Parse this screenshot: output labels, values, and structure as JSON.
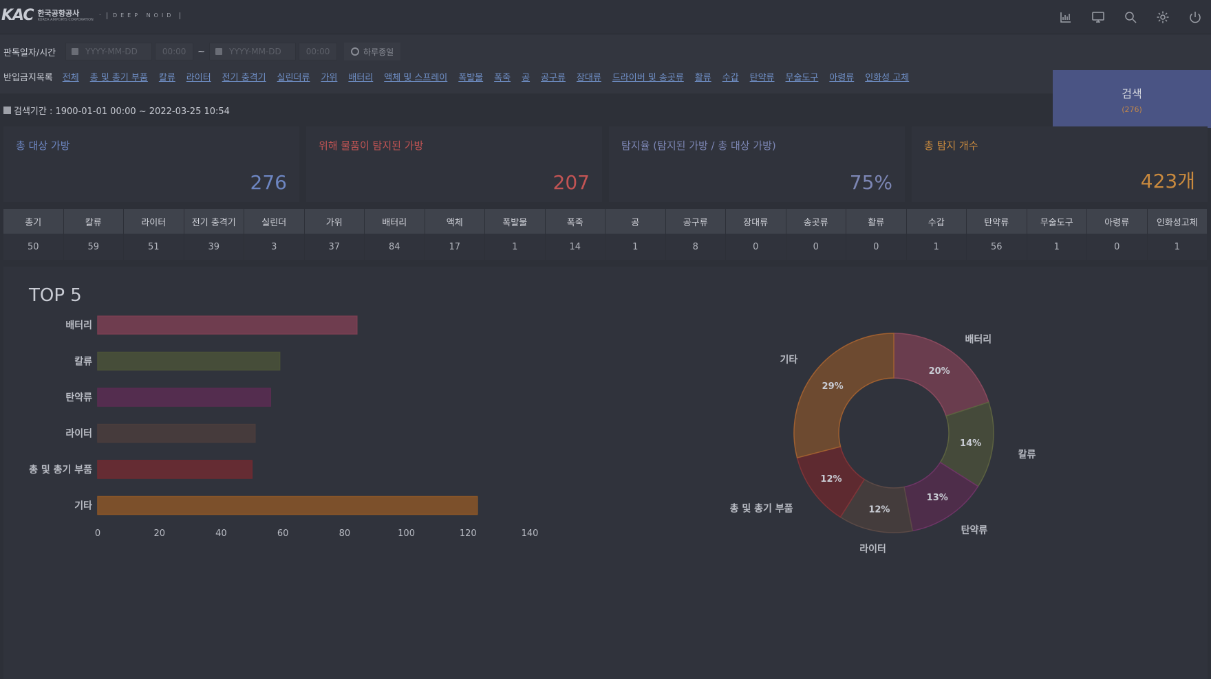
{
  "header": {
    "logo_text": "KAC",
    "logo_ko": "한국공항공사",
    "logo_en": "KOREA AIRPORTS CORPORATION",
    "partner": "DEEP NOID",
    "icons": [
      "chart-icon",
      "monitor-icon",
      "search-icon",
      "gear-icon",
      "power-icon"
    ]
  },
  "filter": {
    "date_label": "판독일자/시간",
    "start_date_placeholder": "YYYY-MM-DD",
    "start_time_placeholder": "00:00",
    "separator": "~",
    "end_date_placeholder": "YYYY-MM-DD",
    "end_time_placeholder": "00:00",
    "all_day_label": "하루종일",
    "category_label": "반입금지목록",
    "categories": [
      "전체",
      "총 및 총기 부품",
      "칼류",
      "라이터",
      "전기 충격기",
      "실린더류",
      "가위",
      "배터리",
      "액체 및 스프레이",
      "폭발물",
      "폭죽",
      "공",
      "공구류",
      "장대류",
      "드라이버 및 송곳류",
      "활류",
      "수갑",
      "탄약류",
      "무술도구",
      "아령류",
      "인화성 고체"
    ],
    "search_label": "검색",
    "search_count": "(276)"
  },
  "period": {
    "text": "검색기간 : 1900-01-01 00:00 ~ 2022-03-25 10:54"
  },
  "cards": [
    {
      "title": "총 대상 가방",
      "value": "276",
      "color": "#6d86c2"
    },
    {
      "title": "위해 물품이 탐지된 가방",
      "value": "207",
      "color": "#c25454"
    },
    {
      "title": "탐지율 (탐지된 가방 / 총 대상 가방)",
      "value": "75%",
      "color": "#7c86b4"
    },
    {
      "title": "총 탐지 개수",
      "value": "423개",
      "color": "#c98a3e"
    }
  ],
  "category_table": {
    "headers": [
      "총기",
      "칼류",
      "라이터",
      "전기 충격기",
      "실린더",
      "가위",
      "배터리",
      "액체",
      "폭발물",
      "폭죽",
      "공",
      "공구류",
      "장대류",
      "송곳류",
      "활류",
      "수갑",
      "탄약류",
      "무술도구",
      "아령류",
      "인화성고체"
    ],
    "values": [
      "50",
      "59",
      "51",
      "39",
      "3",
      "37",
      "84",
      "17",
      "1",
      "14",
      "1",
      "8",
      "0",
      "0",
      "0",
      "1",
      "56",
      "1",
      "0",
      "1"
    ]
  },
  "top5": {
    "title": "TOP 5"
  },
  "chart_data": [
    {
      "type": "bar",
      "orientation": "horizontal",
      "categories": [
        "배터리",
        "칼류",
        "탄약류",
        "라이터",
        "총 및 총기 부품",
        "기타"
      ],
      "values": [
        84,
        59,
        56,
        51,
        50,
        123
      ],
      "colors": [
        "#7a3f52",
        "#4a5238",
        "#5a2d52",
        "#4a3d3c",
        "#6e2b31",
        "#8a5628"
      ],
      "xlim": [
        0,
        140
      ],
      "xticks": [
        0,
        20,
        40,
        60,
        80,
        100,
        120,
        140
      ],
      "grid": false
    },
    {
      "type": "pie",
      "donut": true,
      "labels": [
        "배터리",
        "칼류",
        "탄약류",
        "라이터",
        "총 및 총기 부품",
        "기타"
      ],
      "values": [
        20,
        14,
        13,
        12,
        12,
        29
      ],
      "value_labels": [
        "20%",
        "14%",
        "13%",
        "12%",
        "12%",
        "29%"
      ],
      "colors": [
        "#6a3d4e",
        "#454a3a",
        "#4e2d4a",
        "#443c3c",
        "#5e2a30",
        "#6d4a30"
      ],
      "stroke_colors": [
        "#8a4a5e",
        "#5c6240",
        "#6e3566",
        "#5c4a46",
        "#803438",
        "#a06030"
      ]
    }
  ]
}
